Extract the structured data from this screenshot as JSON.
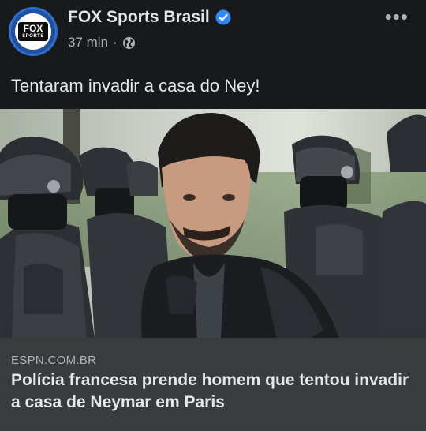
{
  "post": {
    "page_name": "FOX Sports Brasil",
    "time": "37 min",
    "separator": "·",
    "more_label": "•••",
    "caption": "Tentaram invadir a casa do Ney!",
    "avatar_text": "FOX",
    "avatar_subtext": "SPORTS"
  },
  "link": {
    "domain": "ESPN.COM.BR",
    "headline": "Polícia francesa prende homem que tentou invadir a casa de Neymar em Paris"
  },
  "colors": {
    "background": "#18191a",
    "link_box": "#3a3b3c",
    "verified": "#2d88ff"
  },
  "icons": {
    "verified": "verified-badge-icon",
    "privacy": "globe-icon",
    "menu": "more-options-icon"
  }
}
